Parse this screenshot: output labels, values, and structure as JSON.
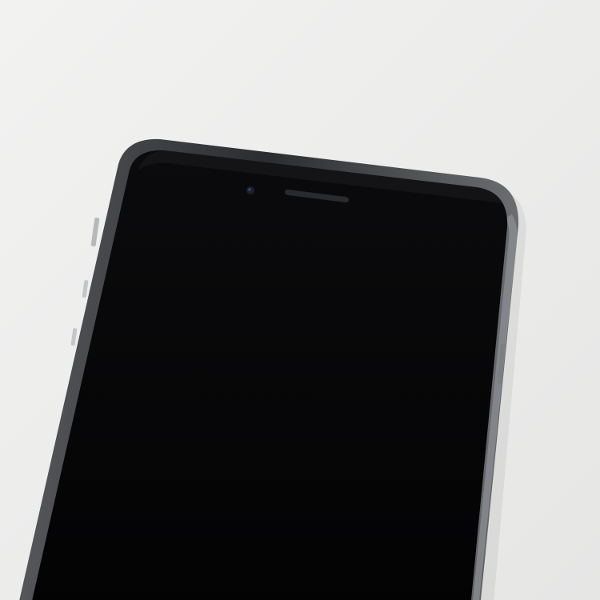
{
  "scene": {
    "subject": "smartphone-front-top",
    "screen_state": "off"
  },
  "colors": {
    "background": "#ededec",
    "frame": "#3a3b3e",
    "frame_highlight": "#9a9ca0",
    "screen": "#050506",
    "earpiece": "#2a2b2e",
    "camera": "#1a2030"
  }
}
